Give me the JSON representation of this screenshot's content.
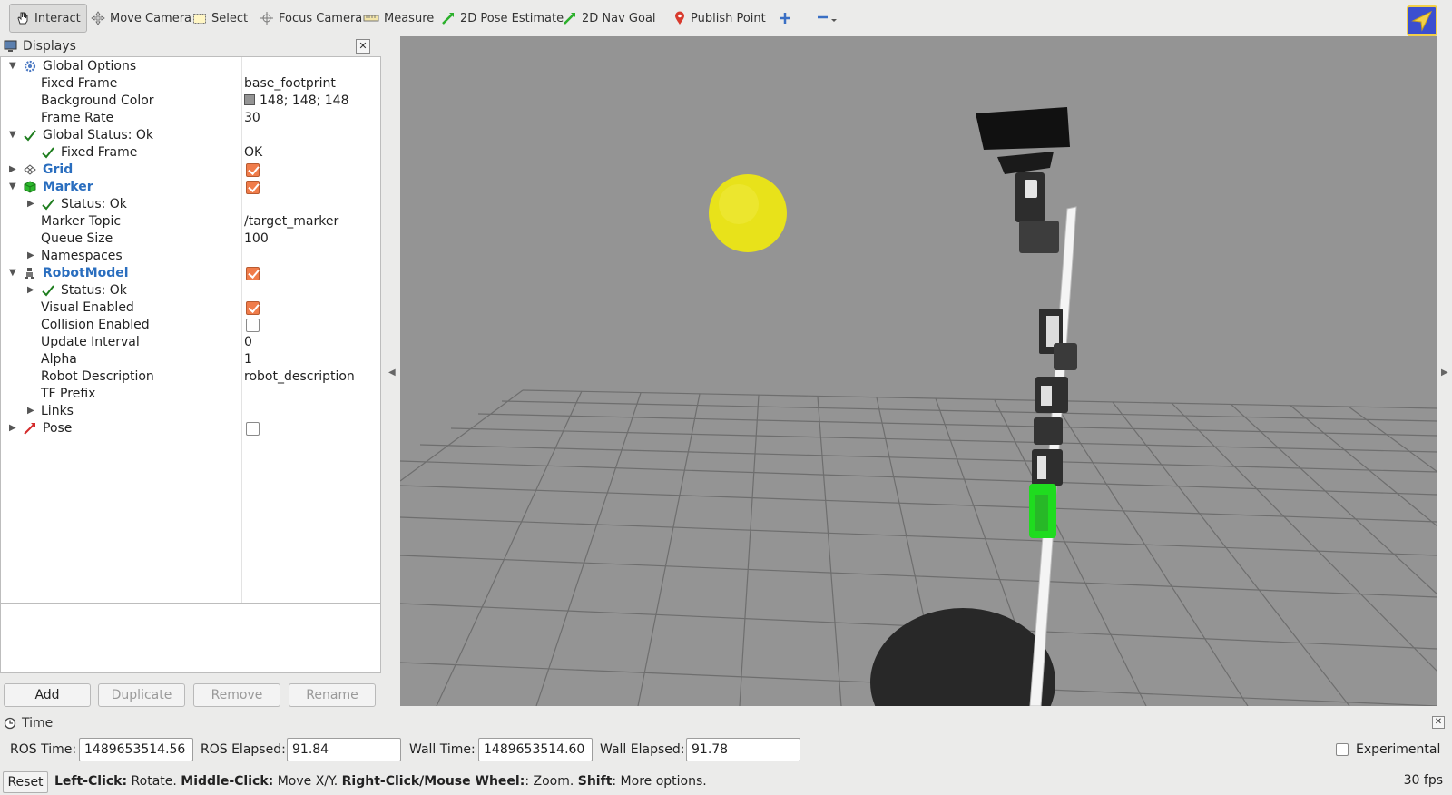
{
  "toolbar": {
    "tools": [
      {
        "label": "Interact",
        "icon": "hand-icon",
        "active": true
      },
      {
        "label": "Move Camera",
        "icon": "move-camera-icon"
      },
      {
        "label": "Select",
        "icon": "select-icon"
      },
      {
        "label": "Focus Camera",
        "icon": "focus-camera-icon"
      },
      {
        "label": "Measure",
        "icon": "ruler-icon"
      },
      {
        "label": "2D Pose Estimate",
        "icon": "green-arrow-icon"
      },
      {
        "label": "2D Nav Goal",
        "icon": "green-arrow-icon"
      },
      {
        "label": "Publish Point",
        "icon": "pin-icon"
      }
    ]
  },
  "displays": {
    "title": "Displays",
    "rows": [
      {
        "name": "Global Options",
        "value": ""
      },
      {
        "name": "Fixed Frame",
        "value": "base_footprint"
      },
      {
        "name": "Background Color",
        "value": "148; 148; 148"
      },
      {
        "name": "Frame Rate",
        "value": "30"
      },
      {
        "name": "Global Status: Ok",
        "value": ""
      },
      {
        "name": "Fixed Frame",
        "value": "OK"
      },
      {
        "name": "Grid",
        "value": "",
        "checked": true
      },
      {
        "name": "Marker",
        "value": "",
        "checked": true
      },
      {
        "name": "Status: Ok",
        "value": ""
      },
      {
        "name": "Marker Topic",
        "value": "/target_marker"
      },
      {
        "name": "Queue Size",
        "value": "100"
      },
      {
        "name": "Namespaces",
        "value": ""
      },
      {
        "name": "RobotModel",
        "value": "",
        "checked": true
      },
      {
        "name": "Status: Ok",
        "value": ""
      },
      {
        "name": "Visual Enabled",
        "value": "",
        "checked": true
      },
      {
        "name": "Collision Enabled",
        "value": "",
        "checked": false
      },
      {
        "name": "Update Interval",
        "value": "0"
      },
      {
        "name": "Alpha",
        "value": "1"
      },
      {
        "name": "Robot Description",
        "value": "robot_description"
      },
      {
        "name": "TF Prefix",
        "value": ""
      },
      {
        "name": "Links",
        "value": ""
      },
      {
        "name": "Pose",
        "value": "",
        "checked": false
      }
    ],
    "buttons": {
      "add": "Add",
      "duplicate": "Duplicate",
      "remove": "Remove",
      "rename": "Rename"
    }
  },
  "colors": {
    "background": "#949494",
    "marker": "#e8e21a",
    "accent_checkbox": "#f07c4a"
  },
  "time": {
    "title": "Time",
    "ros_time_label": "ROS Time:",
    "ros_time": "1489653514.56",
    "ros_elapsed_label": "ROS Elapsed:",
    "ros_elapsed": "91.84",
    "wall_time_label": "Wall Time:",
    "wall_time": "1489653514.60",
    "wall_elapsed_label": "Wall Elapsed:",
    "wall_elapsed": "91.78",
    "experimental_label": "Experimental"
  },
  "statusbar": {
    "reset": "Reset",
    "left_click": "Left-Click:",
    "left_click_desc": " Rotate. ",
    "middle_click": "Middle-Click:",
    "middle_click_desc": " Move X/Y. ",
    "right_click": "Right-Click/Mouse Wheel:",
    "right_click_desc": ": Zoom. ",
    "shift": "Shift",
    "shift_desc": ": More options.",
    "fps": "30 fps"
  }
}
